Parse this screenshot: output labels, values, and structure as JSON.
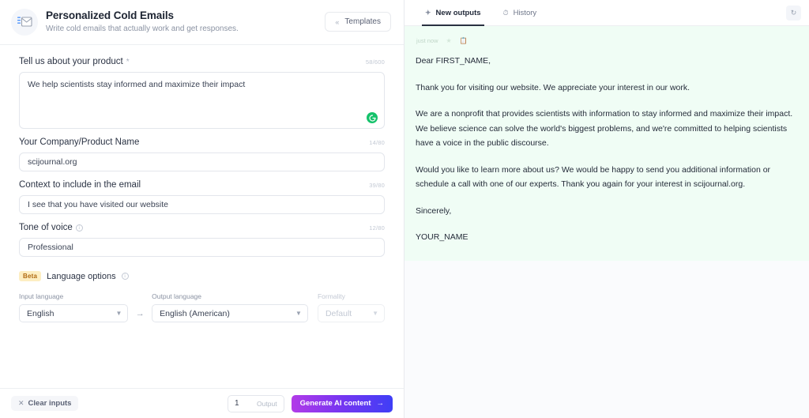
{
  "header": {
    "icon": "email-template-icon",
    "title": "Personalized Cold Emails",
    "subtitle": "Write cold emails that actually work and get responses.",
    "templates_button": {
      "label": "Templates",
      "icon": "double-chevron-left-icon"
    }
  },
  "form": {
    "fields": [
      {
        "label": "Tell us about your product",
        "required_marker": "*",
        "counter": "58/600",
        "value": "We help scientists stay informed and maximize their impact",
        "type": "textarea",
        "assistant_icon": "grammarly-icon"
      },
      {
        "label": "Your Company/Product Name",
        "counter": "14/80",
        "value": "scijournal.org",
        "type": "input"
      },
      {
        "label": "Context to include in the email",
        "counter": "39/80",
        "value": "I see that you have visited our website",
        "type": "input"
      },
      {
        "label": "Tone of voice",
        "info_icon": "info-icon",
        "counter": "12/80",
        "value": "Professional",
        "type": "input"
      }
    ],
    "language_options": {
      "badge": "Beta",
      "label": "Language options",
      "info_icon": "info-icon",
      "input_language": {
        "label": "Input language",
        "value": "English",
        "chevron": "chevron-down-icon"
      },
      "arrow": "→",
      "output_language": {
        "label": "Output language",
        "value": "English (American)",
        "chevron": "chevron-down-icon"
      },
      "formality": {
        "label": "Formality",
        "value": "Default",
        "chevron": "chevron-down-icon",
        "disabled": true
      }
    }
  },
  "bottom_bar": {
    "clear_inputs": {
      "label": "Clear inputs",
      "icon": "close-x-icon"
    },
    "output_count": "1",
    "output_label": "Output",
    "generate_button": {
      "label": "Generate AI content",
      "icon": "arrow-right-icon"
    }
  },
  "output_panel": {
    "tabs": [
      {
        "label": "New outputs",
        "icon": "sparkle-icon",
        "active": true
      },
      {
        "label": "History",
        "icon": "clock-icon",
        "active": false
      }
    ],
    "refresh_icon": "refresh-icon",
    "result": {
      "timestamp": "just now",
      "actions": [
        "star-icon",
        "copy-icon"
      ],
      "paragraphs": [
        "Dear FIRST_NAME,",
        "Thank you for visiting our website. We appreciate your interest in our work.",
        "We are a nonprofit that provides scientists with information to stay informed and maximize their impact. We believe science can solve the world's biggest problems, and we're committed to helping scientists have a voice in the public discourse.",
        "Would you like to learn more about us? We would be happy to send you additional information or schedule a call with one of our experts. Thank you again for your interest in scijournal.org.",
        "Sincerely,",
        "YOUR_NAME"
      ]
    }
  },
  "colors": {
    "accent_gradient_start": "#b23be8",
    "accent_gradient_end": "#3f3ef6",
    "output_background": "#f0fdf5",
    "grammarly_green": "#15c26b",
    "beta_badge_bg": "#fdeec2",
    "beta_badge_text": "#b06a12"
  }
}
